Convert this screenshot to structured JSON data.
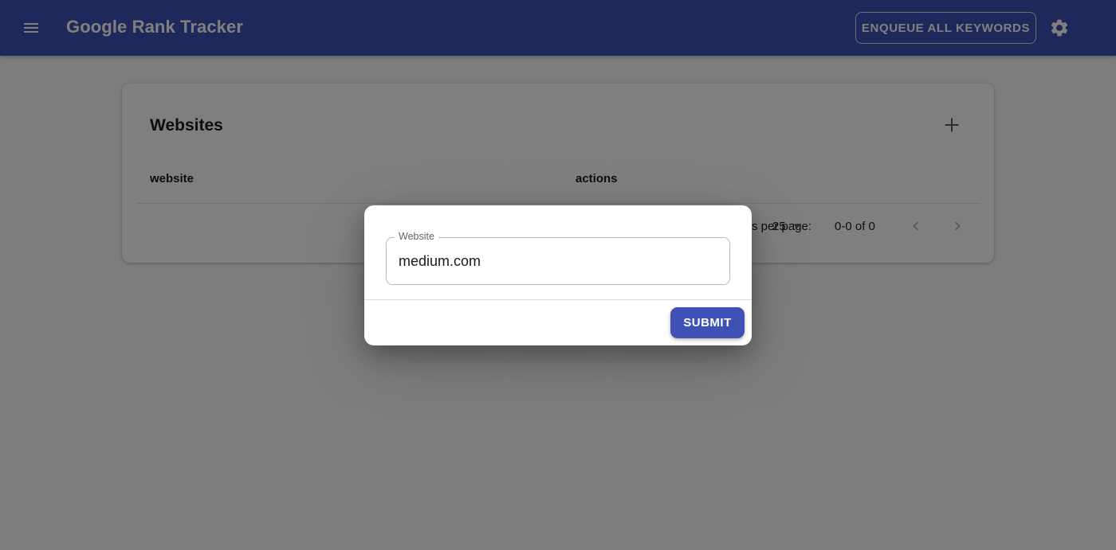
{
  "appbar": {
    "title": "Google Rank Tracker",
    "enqueue_label": "ENQUEUE ALL KEYWORDS",
    "menu_icon": "menu-icon",
    "settings_icon": "gear-icon",
    "color": "#3f51b5"
  },
  "card": {
    "title": "Websites",
    "add_icon": "plus-icon",
    "columns": [
      "website",
      "actions"
    ],
    "rows": [],
    "pagination": {
      "rows_per_page_label": "Rows per page:",
      "rows_per_page": "25",
      "range": "0-0 of 0"
    }
  },
  "dialog": {
    "field_label": "Website",
    "field_value": "medium.com",
    "submit_label": "SUBMIT"
  }
}
